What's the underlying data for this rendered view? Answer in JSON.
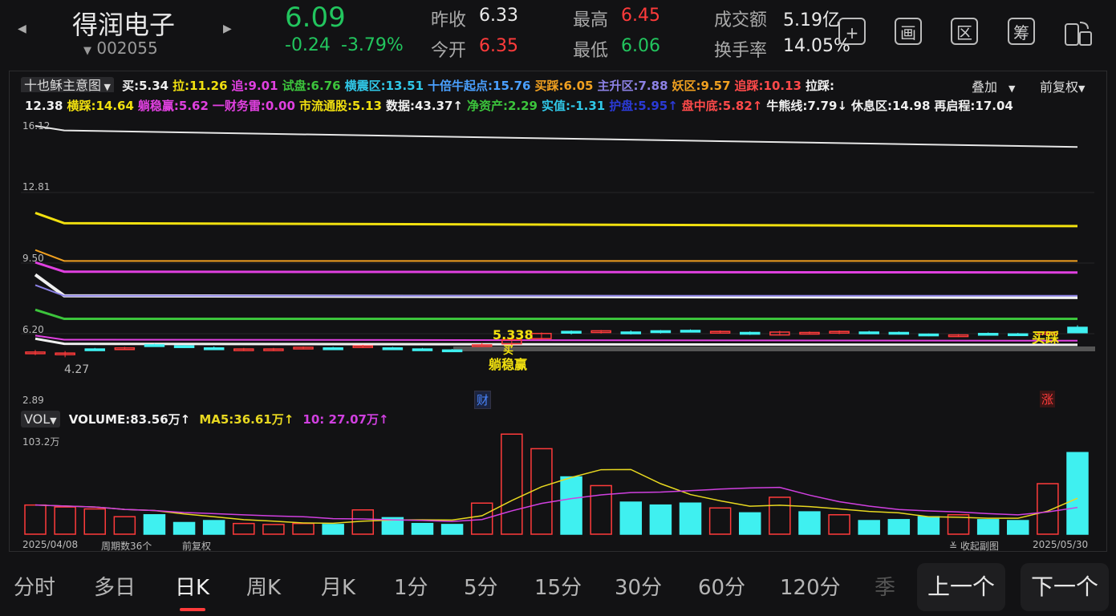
{
  "header": {
    "stock_name": "得润电子",
    "stock_code": "002055",
    "price": "6.09",
    "change": "-0.24",
    "change_pct": "-3.79%",
    "prev_close_label": "昨收",
    "prev_close": "6.33",
    "open_label": "今开",
    "open": "6.35",
    "high_label": "最高",
    "high": "6.45",
    "low_label": "最低",
    "low": "6.06",
    "turnover_label": "成交额",
    "turnover": "5.19亿",
    "turnover_rate_label": "换手率",
    "turnover_rate": "14.05%"
  },
  "toolbar": {
    "add_icon": "+",
    "draw_icon": "画",
    "range_icon": "区",
    "chip_icon": "筹",
    "landscape_icon": "rotate"
  },
  "indicator": {
    "selector": "十也稣主意图",
    "overlay_label": "叠加",
    "adjust_label": "前复权",
    "line1": [
      {
        "text": "买:5.34",
        "color": "#f0f0f0"
      },
      {
        "text": "拉:11.26",
        "color": "#f1e00f"
      },
      {
        "text": "追:9.01",
        "color": "#e040e0"
      },
      {
        "text": "试盘:6.76",
        "color": "#3cc43c"
      },
      {
        "text": "横震区:13.51",
        "color": "#30c8e8"
      },
      {
        "text": "十倍牛起点:15.76",
        "color": "#4aa0ff"
      },
      {
        "text": "买踩:6.05",
        "color": "#f0a020"
      },
      {
        "text": "主升区:7.88",
        "color": "#8d82e6"
      },
      {
        "text": "妖区:9.57",
        "color": "#f0a020"
      },
      {
        "text": "追踩:10.13",
        "color": "#ff4a4a"
      },
      {
        "text": "拉踩:",
        "color": "#f0f0f0"
      }
    ],
    "line2": [
      {
        "text": "12.38",
        "color": "#f0f0f0"
      },
      {
        "text": "横踩:14.64",
        "color": "#f1e00f"
      },
      {
        "text": "躺稳赢:5.62",
        "color": "#e040e0"
      },
      {
        "text": "一财务雷:0.00",
        "color": "#e040e0"
      },
      {
        "text": "市流通股:5.13",
        "color": "#f1e00f"
      },
      {
        "text": "数据:43.37↑",
        "color": "#f0f0f0"
      },
      {
        "text": "净资产:2.29",
        "color": "#3cc43c"
      },
      {
        "text": "实值:-1.31",
        "color": "#30c8e8"
      },
      {
        "text": "护盘:5.95↑",
        "color": "#2b3ad6"
      },
      {
        "text": "盘中底:5.82↑",
        "color": "#ff4a4a"
      },
      {
        "text": "牛熊线:7.79↓",
        "color": "#f0f0f0"
      },
      {
        "text": "休息区:14.98",
        "color": "#f0f0f0"
      },
      {
        "text": "再启程:17.04",
        "color": "#f0f0f0"
      }
    ]
  },
  "price_axis": [
    "16.12",
    "12.81",
    "9.50",
    "6.20",
    "2.89"
  ],
  "low_mark": "4.27",
  "annotations": {
    "buy_price": "5.338",
    "buy_char": "买",
    "steady_win": "躺稳赢",
    "finance_tag": "财",
    "rise_tag": "涨",
    "buy_step": "买踩"
  },
  "volume": {
    "selector": "VOL",
    "volume_label": "VOLUME:83.56万↑",
    "ma5_label": "MA5:36.61万↑",
    "ma10_label": "10: 27.07万↑",
    "max_label": "103.2万",
    "bars": [
      {
        "v": 30,
        "up": true
      },
      {
        "v": 28,
        "up": true
      },
      {
        "v": 26,
        "up": true
      },
      {
        "v": 18,
        "up": true
      },
      {
        "v": 20,
        "up": false
      },
      {
        "v": 12,
        "up": false
      },
      {
        "v": 14,
        "up": false
      },
      {
        "v": 11,
        "up": true
      },
      {
        "v": 10,
        "up": true
      },
      {
        "v": 11,
        "up": true
      },
      {
        "v": 10,
        "up": false
      },
      {
        "v": 25,
        "up": true
      },
      {
        "v": 17,
        "up": false
      },
      {
        "v": 11,
        "up": false
      },
      {
        "v": 10,
        "up": false
      },
      {
        "v": 32,
        "up": true
      },
      {
        "v": 103,
        "up": true
      },
      {
        "v": 88,
        "up": true
      },
      {
        "v": 59,
        "up": false
      },
      {
        "v": 50,
        "up": true
      },
      {
        "v": 33,
        "up": false
      },
      {
        "v": 30,
        "up": false
      },
      {
        "v": 32,
        "up": false
      },
      {
        "v": 27,
        "up": true
      },
      {
        "v": 22,
        "up": false
      },
      {
        "v": 38,
        "up": true
      },
      {
        "v": 23,
        "up": false
      },
      {
        "v": 20,
        "up": true
      },
      {
        "v": 14,
        "up": false
      },
      {
        "v": 15,
        "up": false
      },
      {
        "v": 18,
        "up": false
      },
      {
        "v": 20,
        "up": true
      },
      {
        "v": 15,
        "up": false
      },
      {
        "v": 14,
        "up": false
      },
      {
        "v": 52,
        "up": true
      },
      {
        "v": 84,
        "up": false
      }
    ]
  },
  "footer": {
    "start_date": "2025/04/08",
    "period_count": "周期数36个",
    "adjust": "前复权",
    "collapse": "收起副图",
    "end_date": "2025/05/30"
  },
  "tabs": [
    "分时",
    "多日",
    "日K",
    "周K",
    "月K",
    "1分",
    "5分",
    "15分",
    "30分",
    "60分",
    "120分",
    "季"
  ],
  "active_tab": 2,
  "nav": {
    "prev": "上一个",
    "next": "下一个"
  },
  "colors": {
    "up": "#ff3b3b",
    "down": "#3ff0f0",
    "ma5": "#e8d820",
    "ma10": "#d040e0"
  }
}
